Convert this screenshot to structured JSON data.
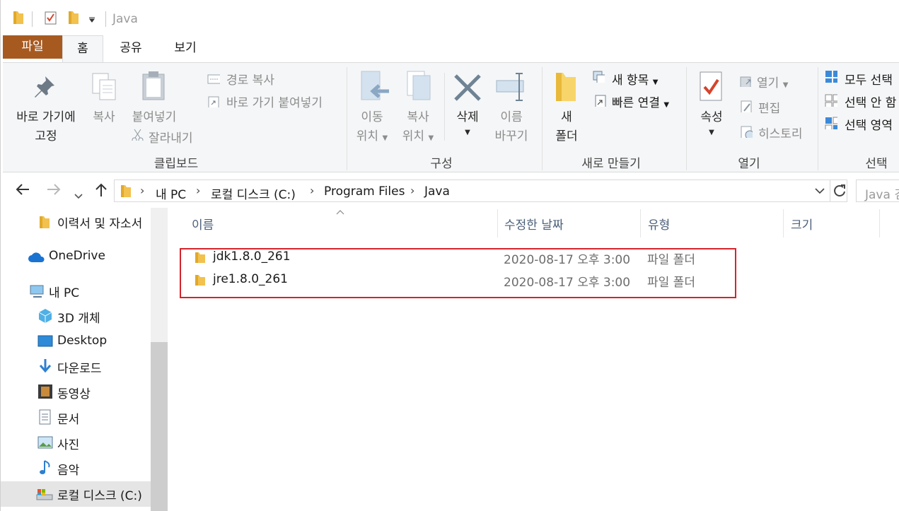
{
  "titlebar": {
    "title": "Java"
  },
  "tabs": {
    "file": "파일",
    "home": "홈",
    "share": "공유",
    "view": "보기"
  },
  "ribbon": {
    "clipboard": {
      "pin": [
        "바로 가기에",
        "고정"
      ],
      "copy": "복사",
      "paste": "붙여넣기",
      "copy_path": "경로 복사",
      "paste_shortcut": "바로 가기 붙여넣기",
      "cut": "잘라내기",
      "group": "클립보드"
    },
    "organize": {
      "move_to": [
        "이동",
        "위치"
      ],
      "copy_to": [
        "복사",
        "위치"
      ],
      "delete": "삭제",
      "rename": [
        "이름",
        "바꾸기"
      ],
      "group": "구성"
    },
    "new": {
      "new_folder": [
        "새",
        "폴더"
      ],
      "new_item": "새 항목",
      "easy_access": "빠른 연결",
      "group": "새로 만들기"
    },
    "open": {
      "properties": "속성",
      "open": "열기",
      "edit": "편집",
      "history": "히스토리",
      "group": "열기"
    },
    "select": {
      "select_all": "모두 선택",
      "select_none": "선택 안 함",
      "invert": "선택 영역",
      "group": "선택"
    }
  },
  "address": {
    "crumbs": [
      "내 PC",
      "로컬 디스크 (C:)",
      "Program Files",
      "Java"
    ],
    "search_placeholder": "Java 검색"
  },
  "nav": {
    "items": [
      {
        "label": "이력서 및 자소서",
        "icon": "folder-icon"
      },
      {
        "label": "OneDrive",
        "icon": "onedrive-icon"
      },
      {
        "label": "내 PC",
        "icon": "pc-icon"
      },
      {
        "label": "3D 개체",
        "icon": "3d-objects-icon"
      },
      {
        "label": "Desktop",
        "icon": "desktop-icon"
      },
      {
        "label": "다운로드",
        "icon": "download-icon"
      },
      {
        "label": "동영상",
        "icon": "video-icon"
      },
      {
        "label": "문서",
        "icon": "documents-icon"
      },
      {
        "label": "사진",
        "icon": "pictures-icon"
      },
      {
        "label": "음악",
        "icon": "music-icon"
      },
      {
        "label": "로컬 디스크 (C:)",
        "icon": "drive-icon"
      }
    ]
  },
  "columns": {
    "name": "이름",
    "modified": "수정한 날짜",
    "type": "유형",
    "size": "크기"
  },
  "files": [
    {
      "name": "jdk1.8.0_261",
      "modified": "2020-08-17 오후 3:00",
      "type": "파일 폴더"
    },
    {
      "name": "jre1.8.0_261",
      "modified": "2020-08-17 오후 3:00",
      "type": "파일 폴더"
    }
  ],
  "colors": {
    "file_tab": "#a75a20",
    "highlight_box": "#d4242c",
    "folder": "#f2c14e"
  }
}
